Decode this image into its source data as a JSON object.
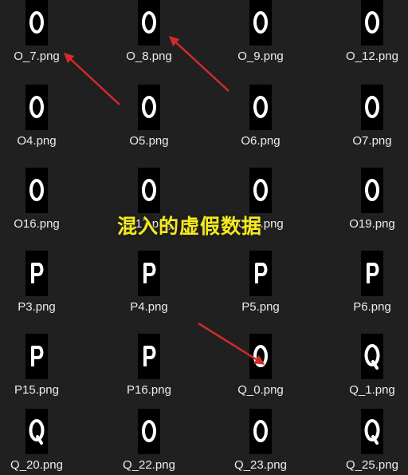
{
  "overlay_caption": "混入的虚假数据",
  "annotation_color": "#d42a2a",
  "caption_color": "#f7ea1c",
  "files": [
    {
      "name": "O_7.png",
      "glyph": "O",
      "icon": "image-thumbnail-O"
    },
    {
      "name": "O_8.png",
      "glyph": "O",
      "icon": "image-thumbnail-O"
    },
    {
      "name": "O_9.png",
      "glyph": "O",
      "icon": "image-thumbnail-O"
    },
    {
      "name": "O_12.png",
      "glyph": "O",
      "icon": "image-thumbnail-O"
    },
    {
      "name": "O4.png",
      "glyph": "O",
      "icon": "image-thumbnail-O"
    },
    {
      "name": "O5.png",
      "glyph": "O",
      "icon": "image-thumbnail-O"
    },
    {
      "name": "O6.png",
      "glyph": "O",
      "icon": "image-thumbnail-O"
    },
    {
      "name": "O7.png",
      "glyph": "O",
      "icon": "image-thumbnail-O"
    },
    {
      "name": "O16.png",
      "glyph": "O",
      "icon": "image-thumbnail-O"
    },
    {
      "name": "O17.png",
      "glyph": "O",
      "icon": "image-thumbnail-O"
    },
    {
      "name": "O18.png",
      "glyph": "O",
      "icon": "image-thumbnail-O"
    },
    {
      "name": "O19.png",
      "glyph": "O",
      "icon": "image-thumbnail-O"
    },
    {
      "name": "P3.png",
      "glyph": "P",
      "icon": "image-thumbnail-P"
    },
    {
      "name": "P4.png",
      "glyph": "P",
      "icon": "image-thumbnail-P"
    },
    {
      "name": "P5.png",
      "glyph": "P",
      "icon": "image-thumbnail-P"
    },
    {
      "name": "P6.png",
      "glyph": "P",
      "icon": "image-thumbnail-P"
    },
    {
      "name": "P15.png",
      "glyph": "P",
      "icon": "image-thumbnail-P"
    },
    {
      "name": "P16.png",
      "glyph": "P",
      "icon": "image-thumbnail-P"
    },
    {
      "name": "Q_0.png",
      "glyph": "O",
      "icon": "image-thumbnail-O"
    },
    {
      "name": "Q_1.png",
      "glyph": "Q",
      "icon": "image-thumbnail-Q"
    },
    {
      "name": "Q_20.png",
      "glyph": "Q",
      "icon": "image-thumbnail-Q"
    },
    {
      "name": "Q_22.png",
      "glyph": "O",
      "icon": "image-thumbnail-O"
    },
    {
      "name": "Q_23.png",
      "glyph": "O",
      "icon": "image-thumbnail-O"
    },
    {
      "name": "Q_25.png",
      "glyph": "Q",
      "icon": "image-thumbnail-Q"
    }
  ]
}
